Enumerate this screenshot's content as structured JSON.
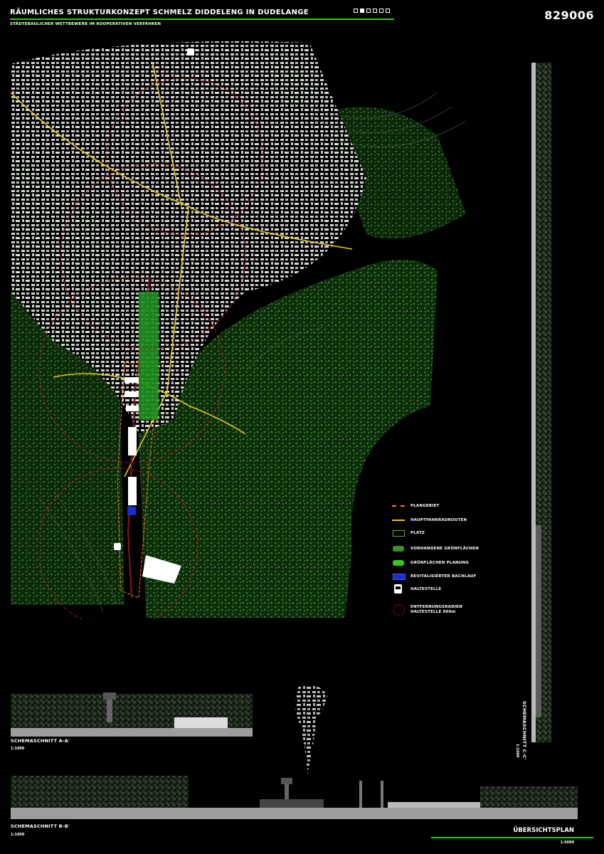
{
  "header": {
    "title": "RÄUMLICHES STRUKTURKONZEPT SCHMELZ DIDDELENG IN DUDELANGE",
    "subtitle": "STÄDTEBAULICHER WETTBEWERB IM KOOPERATIVEN VERFAHREN",
    "code": "829006",
    "page_indicator": {
      "total": 6,
      "active_index": 2
    }
  },
  "legend": [
    {
      "label": "PLANGEBIET",
      "symbol": "dashed-orange-line",
      "color": "#ff7a1a"
    },
    {
      "label": "HAUPTFAHRRADROUTEN",
      "symbol": "yellow-line",
      "color": "#e3c81e"
    },
    {
      "label": "PLATZ",
      "symbol": "outline-box",
      "color": "#6aa84f"
    },
    {
      "label": "VORHANDENE GRÜNFLÄCHEN",
      "symbol": "green-texture",
      "color": "#3b8f2a"
    },
    {
      "label": "GRÜNFLÄCHEN PLANUNG",
      "symbol": "green-texture-bright",
      "color": "#38c42a"
    },
    {
      "label": "REVITALISIERTER BACHLAUF",
      "symbol": "blue-box",
      "color": "#1a2bd0"
    },
    {
      "label": "HALTESTELLE",
      "symbol": "train-icon",
      "color": "#ffffff"
    },
    {
      "label": "ENTFERNUNGSRADIEN\nHALTESTELLE 600m",
      "symbol": "red-dashed-circle",
      "color": "#b3141b"
    }
  ],
  "sections": {
    "a": {
      "label": "SCHEMASCHNITT A-A'",
      "scale": "1:1000"
    },
    "b": {
      "label": "SCHEMASCHNITT B-B'",
      "scale": "1:1000"
    },
    "c": {
      "label": "SCHEMASCHNITT C-C'",
      "scale": "1:1000"
    }
  },
  "overview": {
    "title": "ÜBERSICHTSPLAN",
    "scale": "1:5000"
  }
}
